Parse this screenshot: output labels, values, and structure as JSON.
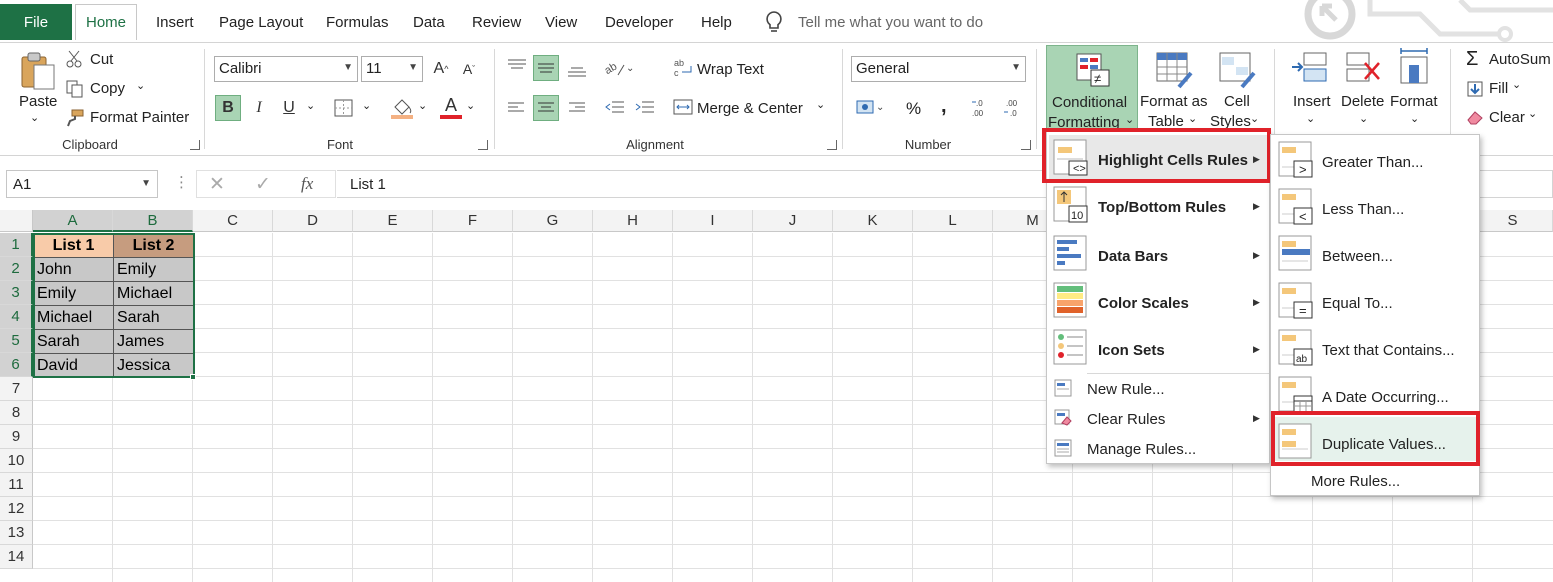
{
  "tabs": {
    "file": "File",
    "items": [
      "Home",
      "Insert",
      "Page Layout",
      "Formulas",
      "Data",
      "Review",
      "View",
      "Developer",
      "Help"
    ],
    "tell_me": "Tell me what you want to do"
  },
  "ribbon": {
    "clipboard": {
      "paste": "Paste",
      "cut": "Cut",
      "copy": "Copy",
      "format_painter": "Format Painter",
      "label": "Clipboard"
    },
    "font": {
      "name": "Calibri",
      "size": "11",
      "bold": "B",
      "italic": "I",
      "underline": "U",
      "font_color": "A",
      "label": "Font"
    },
    "alignment": {
      "wrap_text": "Wrap Text",
      "merge_center": "Merge & Center",
      "label": "Alignment"
    },
    "number": {
      "format": "General",
      "percent": "%",
      "comma": ",",
      "label": "Number"
    },
    "styles": {
      "cond_fmt_1": "Conditional",
      "cond_fmt_2": "Formatting",
      "fmt_table_1": "Format as",
      "fmt_table_2": "Table",
      "cell_styles_1": "Cell",
      "cell_styles_2": "Styles"
    },
    "cells": {
      "insert": "Insert",
      "delete": "Delete",
      "format": "Format"
    },
    "editing": {
      "autosum": "AutoSum",
      "fill": "Fill",
      "clear": "Clear"
    }
  },
  "formula_bar": {
    "name_box": "A1",
    "fx": "fx",
    "content": "List 1"
  },
  "columns": [
    "A",
    "B",
    "C",
    "D",
    "E",
    "F",
    "G",
    "H",
    "I",
    "J",
    "K",
    "L",
    "M",
    "S"
  ],
  "rows": [
    "1",
    "2",
    "3",
    "4",
    "5",
    "6",
    "7",
    "8",
    "9",
    "10",
    "11",
    "12",
    "13",
    "14"
  ],
  "table": {
    "header": [
      "List 1",
      "List 2"
    ],
    "rows": [
      [
        "John",
        "Emily"
      ],
      [
        "Emily",
        "Michael"
      ],
      [
        "Michael",
        "Sarah"
      ],
      [
        "Sarah",
        "James"
      ],
      [
        "David",
        "Jessica"
      ]
    ]
  },
  "cf_menu": {
    "items": [
      "Highlight Cells Rules",
      "Top/Bottom Rules",
      "Data Bars",
      "Color Scales",
      "Icon Sets"
    ],
    "small_items": [
      "New Rule...",
      "Clear Rules",
      "Manage Rules..."
    ]
  },
  "sub_menu": {
    "items": [
      "Greater Than...",
      "Less Than...",
      "Between...",
      "Equal To...",
      "Text that Contains...",
      "A Date Occurring...",
      "Duplicate Values..."
    ],
    "more": "More Rules...",
    "icon_glyphs": [
      ">",
      "<",
      "",
      "=",
      "ab",
      "",
      ""
    ]
  },
  "icons": {
    "topbottom_number": "10"
  },
  "colors": {
    "excel_green": "#1e7145",
    "highlight_red": "#e0222a",
    "list1_header": "#f8cba9",
    "list2_header": "#c69c7f",
    "data_fill": "#c8c8c8"
  }
}
